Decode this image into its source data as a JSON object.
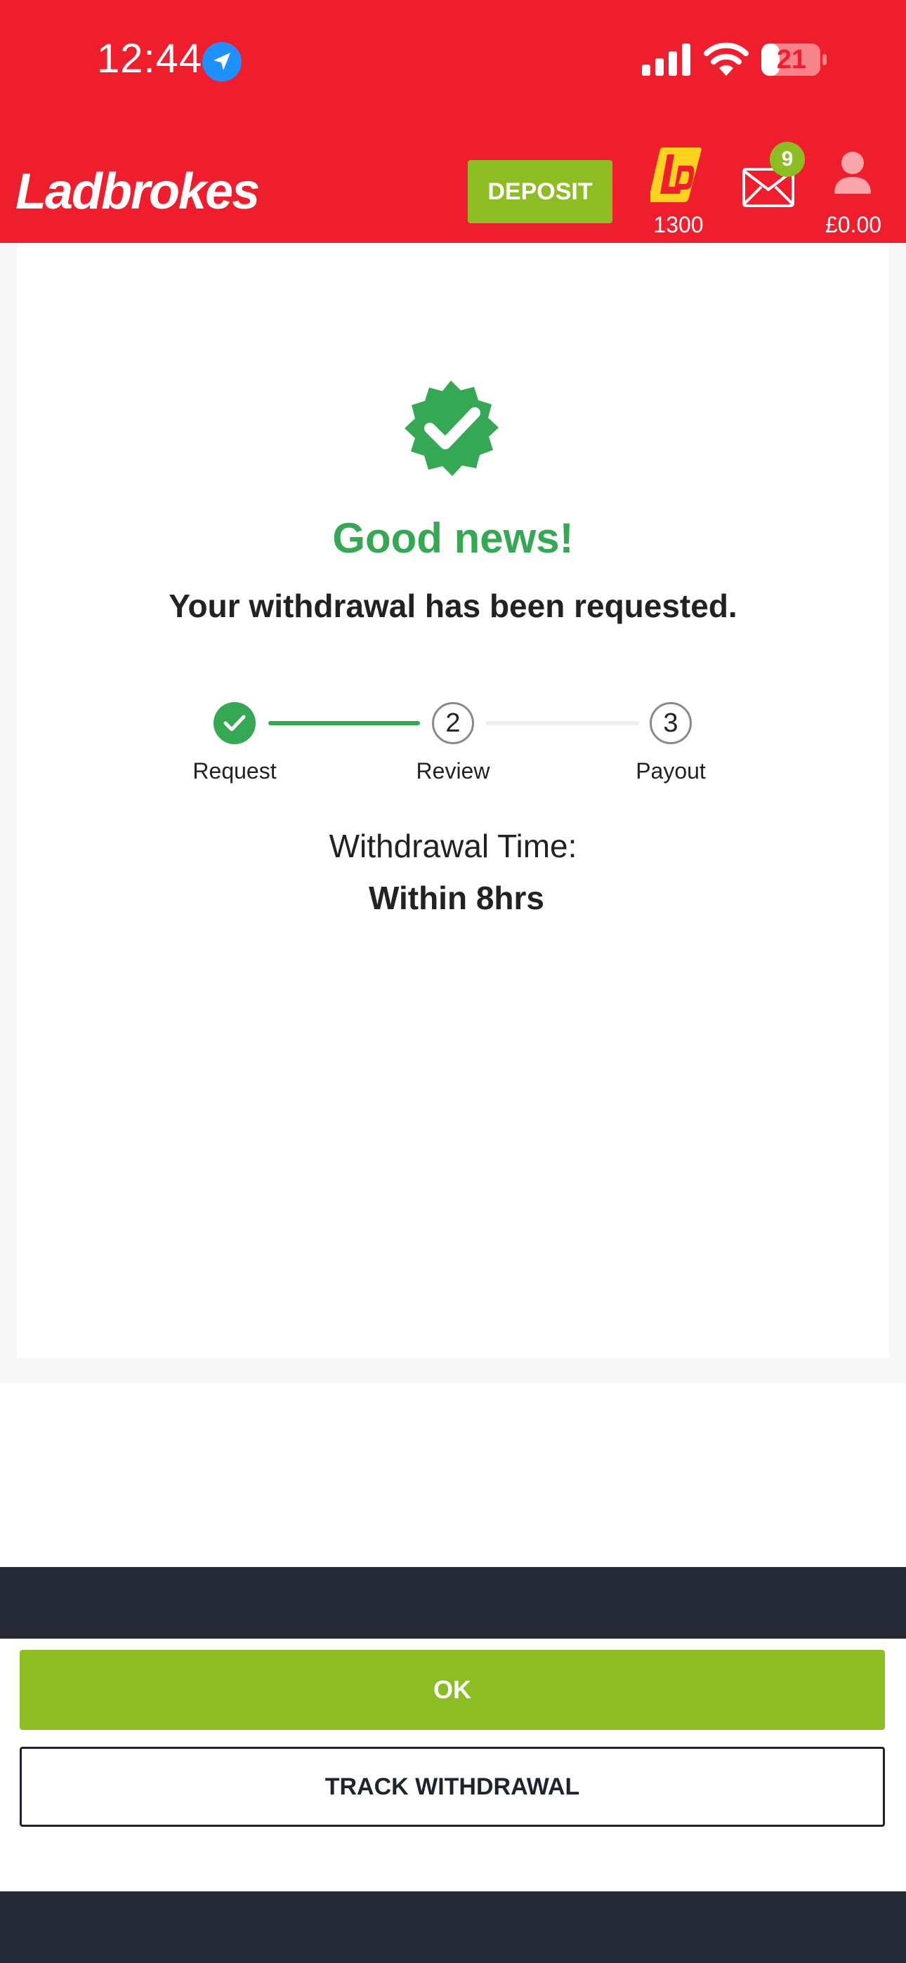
{
  "status_bar": {
    "time": "12:44",
    "battery": "21",
    "icons": [
      "location-arrow-icon",
      "cellular-signal-icon",
      "wifi-icon",
      "battery-icon"
    ]
  },
  "header": {
    "logo": "Ladbrokes",
    "deposit_label": "DEPOSIT",
    "ladbucks_count": "1300",
    "mail_badge": "9",
    "balance": "£0.00",
    "icons": [
      "ladbucks-icon",
      "mail-icon",
      "user-icon"
    ]
  },
  "confirmation": {
    "title": "Good news!",
    "message": "Your withdrawal has been requested."
  },
  "stepper": {
    "steps": [
      {
        "label": "Request",
        "number": "",
        "state": "complete"
      },
      {
        "label": "Review",
        "number": "2",
        "state": "pending"
      },
      {
        "label": "Payout",
        "number": "3",
        "state": "pending"
      }
    ]
  },
  "withdrawal_time": {
    "label": "Withdrawal Time:",
    "value": "Within 8hrs"
  },
  "actions": {
    "ok_label": "OK",
    "track_label": "TRACK WITHDRAWAL"
  },
  "colors": {
    "brand_red": "#f01e2c",
    "accent_green": "#8cbd22",
    "success_green": "#34a853",
    "dark_navy": "#262a36"
  }
}
